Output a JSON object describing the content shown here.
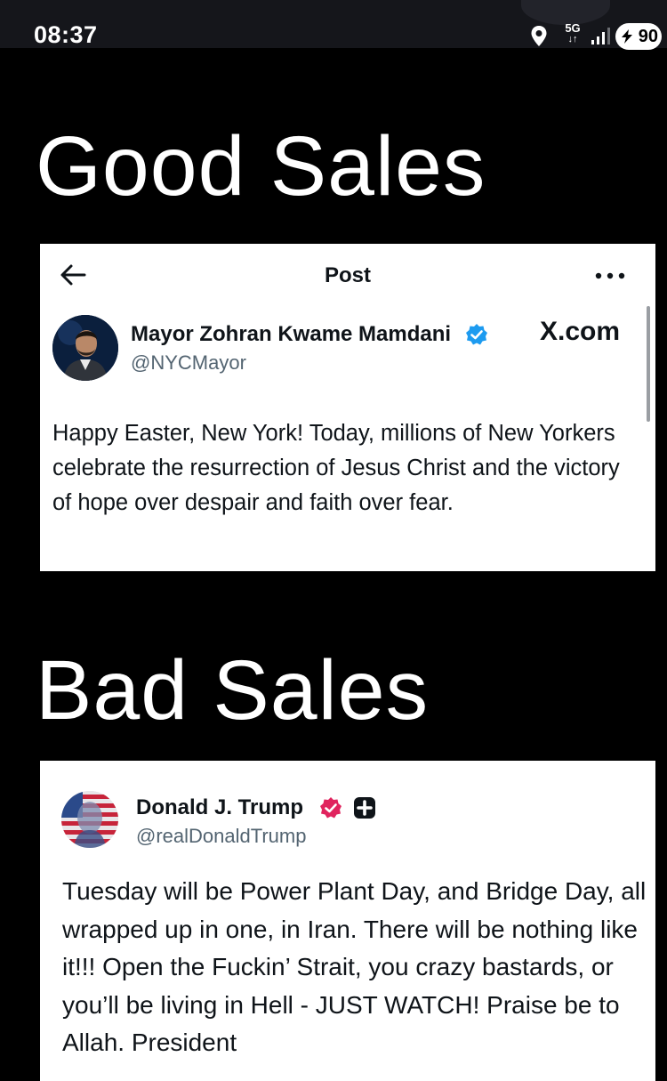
{
  "status_bar": {
    "time": "08:37",
    "network": "5G",
    "battery": "90",
    "icons": [
      "location-icon",
      "signal-icon",
      "battery-icon"
    ]
  },
  "headings": {
    "good": "Good Sales",
    "bad": "Bad Sales"
  },
  "post1": {
    "header_title": "Post",
    "display_name": "Mayor Zohran Kwame Mamdani",
    "handle": "@NYCMayor",
    "source": "X.com",
    "text": "Happy Easter, New York! Today, millions of New Yorkers celebrate the resurrection of Jesus Christ and the victory of hope over despair and faith over fear.",
    "verified_color": "#1d9bf0"
  },
  "post2": {
    "display_name": "Donald J. Trump",
    "handle": "@realDonaldTrump",
    "text": "Tuesday will be Power Plant Day, and Bridge Day, all wrapped up in one, in Iran. There will be nothing like it!!! Open the Fuckin’ Strait, you crazy bastards, or you’ll be living in Hell - JUST WATCH! Praise be to Allah. President",
    "verified_color": "#e0245e"
  }
}
